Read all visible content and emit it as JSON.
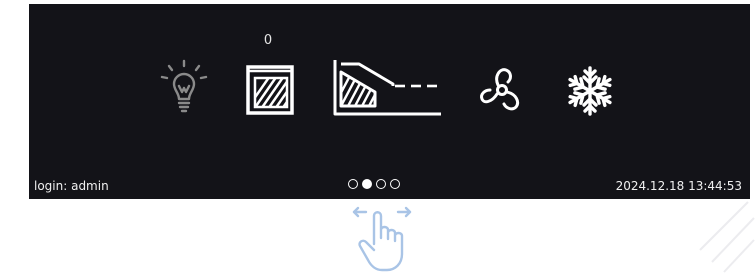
{
  "status_bar": {
    "login_text": "login: admin",
    "datetime": "2024.12.18 13:44:53"
  },
  "counter": {
    "value": "0"
  },
  "pager": {
    "pages": 4,
    "active_index": 1
  },
  "icons": [
    "lightbulb-icon",
    "door-open-icon",
    "ramp-profile-icon",
    "fan-icon",
    "snowflake-icon"
  ],
  "gesture": {
    "icon": "swipe-hand-icon"
  },
  "colors": {
    "panel_bg": "#131318",
    "icon_bright": "#ffffff",
    "icon_dim": "#8a8a8a",
    "gesture_color": "#a9c4e6"
  }
}
